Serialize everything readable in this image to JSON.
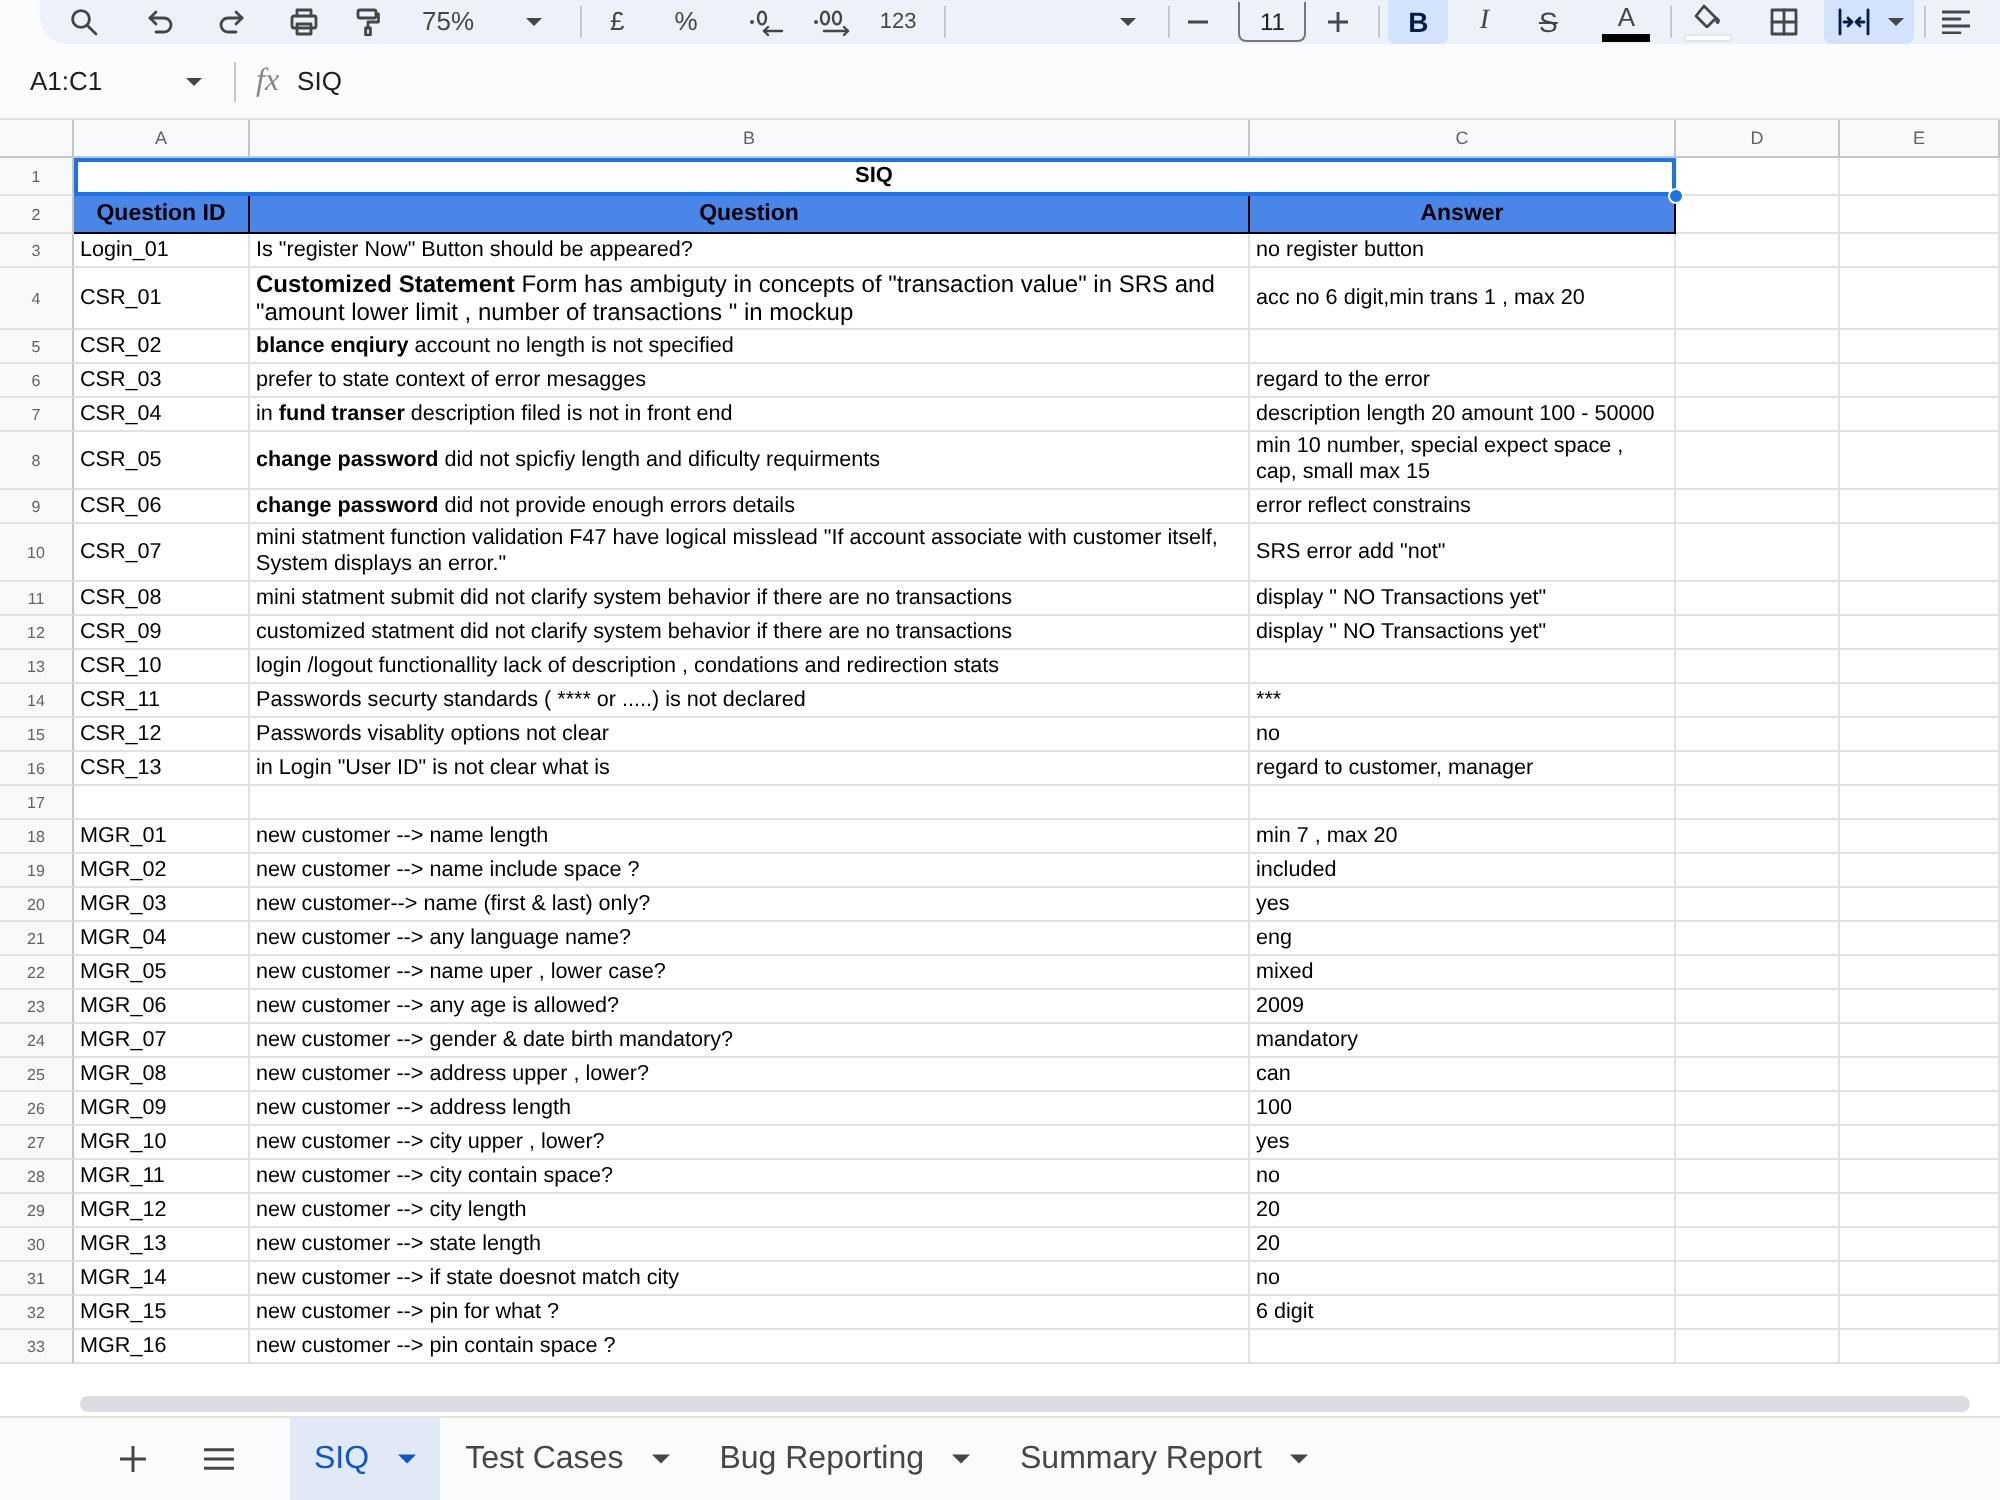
{
  "toolbar": {
    "zoom": "75%",
    "currency": "£",
    "percent": "%",
    "number_format": "123",
    "font_size": "11",
    "bold": {
      "label": "B",
      "on": true
    },
    "italic": {
      "label": "I",
      "on": false
    },
    "strikethrough": {
      "label": "S",
      "on": false
    },
    "text_color": {
      "label": "A",
      "color": "#000000"
    },
    "fill_color": {
      "color": "#ffffff"
    },
    "merge_cells": {
      "on": true
    }
  },
  "formula_bar": {
    "cell_range": "A1:C1",
    "function_label": "fx",
    "value": "SIQ"
  },
  "sheet": {
    "columns": [
      "A",
      "B",
      "C",
      "D",
      "E"
    ],
    "rows": [
      {
        "number": "1",
        "kind": "title",
        "selected": true,
        "cells": [
          "SIQ"
        ]
      },
      {
        "number": "2",
        "kind": "header",
        "selected": false,
        "cells": [
          "Question ID",
          "Question",
          "Answer"
        ]
      },
      {
        "number": "3",
        "kind": "data",
        "selected": false,
        "cells": [
          "Login_01",
          "Is \"register Now\" Button should be appeared?",
          "no register button"
        ]
      },
      {
        "number": "4",
        "kind": "large",
        "selected": false,
        "cells": [
          "CSR_01",
          "**Customized Statement** Form has ambiguty in concepts of \"transaction value\" in SRS and \"amount lower limit , number of transactions \" in mockup",
          "acc no 6 digit,min trans 1 , max 20"
        ]
      },
      {
        "number": "5",
        "kind": "data",
        "selected": false,
        "cells": [
          "CSR_02",
          "**blance enqiury** account no length is not specified"
        ]
      },
      {
        "number": "6",
        "kind": "data",
        "selected": false,
        "cells": [
          "CSR_03",
          "prefer to state context of error mesagges",
          "regard to the error"
        ]
      },
      {
        "number": "7",
        "kind": "data",
        "selected": false,
        "cells": [
          "CSR_04",
          "in **fund transer** description filed is not in front end",
          "description length 20 amount 100 - 50000"
        ]
      },
      {
        "number": "8",
        "kind": "data",
        "selected": false,
        "cells": [
          "CSR_05",
          "**change password** did not spicfiy length and dificulty requirments",
          "min 10 number, special expect space , cap, small max 15"
        ]
      },
      {
        "number": "9",
        "kind": "data",
        "selected": false,
        "cells": [
          "CSR_06",
          "**change password** did not provide enough errors details",
          "error reflect constrains"
        ]
      },
      {
        "number": "10",
        "kind": "data",
        "selected": false,
        "cells": [
          "CSR_07",
          "mini statment function validation F47 have logical misslead \"If account associate with customer itself, System displays an error.\"",
          "SRS error add \"not\""
        ]
      },
      {
        "number": "11",
        "kind": "data",
        "selected": false,
        "cells": [
          "CSR_08",
          "mini statment submit did not clarify system behavior if there are no transactions",
          "display \" NO Transactions yet\""
        ]
      },
      {
        "number": "12",
        "kind": "data",
        "selected": false,
        "cells": [
          "CSR_09",
          "customized statment did not clarify system behavior if there are no transactions",
          "display \" NO Transactions yet\""
        ]
      },
      {
        "number": "13",
        "kind": "data",
        "selected": false,
        "cells": [
          "CSR_10",
          "login /logout functionallity lack of description , condations and redirection stats"
        ]
      },
      {
        "number": "14",
        "kind": "data",
        "selected": false,
        "cells": [
          "CSR_11",
          "Passwords securty standards ( **** or .....) is not declared",
          "***"
        ]
      },
      {
        "number": "15",
        "kind": "data",
        "selected": false,
        "cells": [
          "CSR_12",
          "Passwords visablity options not clear",
          "no"
        ]
      },
      {
        "number": "16",
        "kind": "data",
        "selected": false,
        "cells": [
          "CSR_13",
          "in Login \"User ID\" is not clear what is",
          "regard to customer, manager"
        ]
      },
      {
        "number": "17",
        "kind": "data",
        "selected": false
      },
      {
        "number": "18",
        "kind": "data",
        "selected": false,
        "cells": [
          "MGR_01",
          "new customer --> name length",
          "min 7 , max 20"
        ]
      },
      {
        "number": "19",
        "kind": "data",
        "selected": false,
        "cells": [
          "MGR_02",
          "new customer --> name include space ?",
          "included"
        ]
      },
      {
        "number": "20",
        "kind": "data",
        "selected": false,
        "cells": [
          "MGR_03",
          "new customer--> name (first & last) only?",
          "yes"
        ]
      },
      {
        "number": "21",
        "kind": "data",
        "selected": false,
        "cells": [
          "MGR_04",
          "new customer --> any language name?",
          "eng"
        ]
      },
      {
        "number": "22",
        "kind": "data",
        "selected": false,
        "cells": [
          "MGR_05",
          "new customer --> name uper , lower case?",
          "mixed"
        ]
      },
      {
        "number": "23",
        "kind": "data",
        "selected": false,
        "cells": [
          "MGR_06",
          "new customer --> any age is allowed?",
          "2009"
        ]
      },
      {
        "number": "24",
        "kind": "data",
        "selected": false,
        "cells": [
          "MGR_07",
          "new customer --> gender & date birth mandatory?",
          "mandatory"
        ]
      },
      {
        "number": "25",
        "kind": "data",
        "selected": false,
        "cells": [
          "MGR_08",
          "new customer --> address upper , lower?",
          "can"
        ]
      },
      {
        "number": "26",
        "kind": "data",
        "selected": false,
        "cells": [
          "MGR_09",
          "new customer --> address length",
          "100"
        ]
      },
      {
        "number": "27",
        "kind": "data",
        "selected": false,
        "cells": [
          "MGR_10",
          "new customer --> city upper , lower?",
          "yes"
        ]
      },
      {
        "number": "28",
        "kind": "data",
        "selected": false,
        "cells": [
          "MGR_11",
          "new customer --> city contain space?",
          "no"
        ]
      },
      {
        "number": "29",
        "kind": "data",
        "selected": false,
        "cells": [
          "MGR_12",
          "new customer --> city length",
          "20"
        ]
      },
      {
        "number": "30",
        "kind": "data",
        "selected": false,
        "cells": [
          "MGR_13",
          "new customer --> state length",
          "20"
        ]
      },
      {
        "number": "31",
        "kind": "data",
        "selected": false,
        "cells": [
          "MGR_14",
          "new customer --> if state doesnot match city",
          "no"
        ]
      },
      {
        "number": "32",
        "kind": "data",
        "selected": false,
        "cells": [
          "MGR_15",
          "new customer --> pin for what ?",
          "6 digit"
        ]
      },
      {
        "number": "33",
        "kind": "data",
        "selected": false,
        "cells": [
          "MGR_16",
          "new customer --> pin contain space ?"
        ]
      }
    ]
  },
  "sheet_tabs": [
    {
      "label": "SIQ",
      "selected": true
    },
    {
      "label": "Test Cases",
      "selected": false
    },
    {
      "label": "Bug Reporting",
      "selected": false
    },
    {
      "label": "Summary Report",
      "selected": false
    }
  ]
}
